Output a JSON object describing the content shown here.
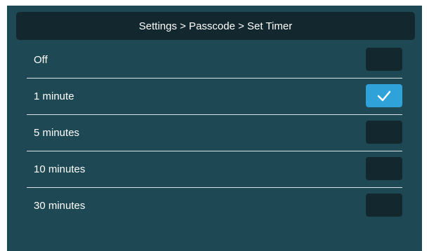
{
  "header": {
    "breadcrumb": "Settings > Passcode > Set Timer"
  },
  "options": [
    {
      "label": "Off",
      "checked": false
    },
    {
      "label": "1 minute",
      "checked": true
    },
    {
      "label": "5 minutes",
      "checked": false
    },
    {
      "label": "10 minutes",
      "checked": false
    },
    {
      "label": "30 minutes",
      "checked": false
    }
  ],
  "colors": {
    "background": "#1d4854",
    "header_bg": "#13272e",
    "checkbox_off": "#13272e",
    "checkbox_on": "#2fa3d9",
    "divider": "#d9e3e6"
  },
  "icons": {
    "checked": "check-icon"
  }
}
